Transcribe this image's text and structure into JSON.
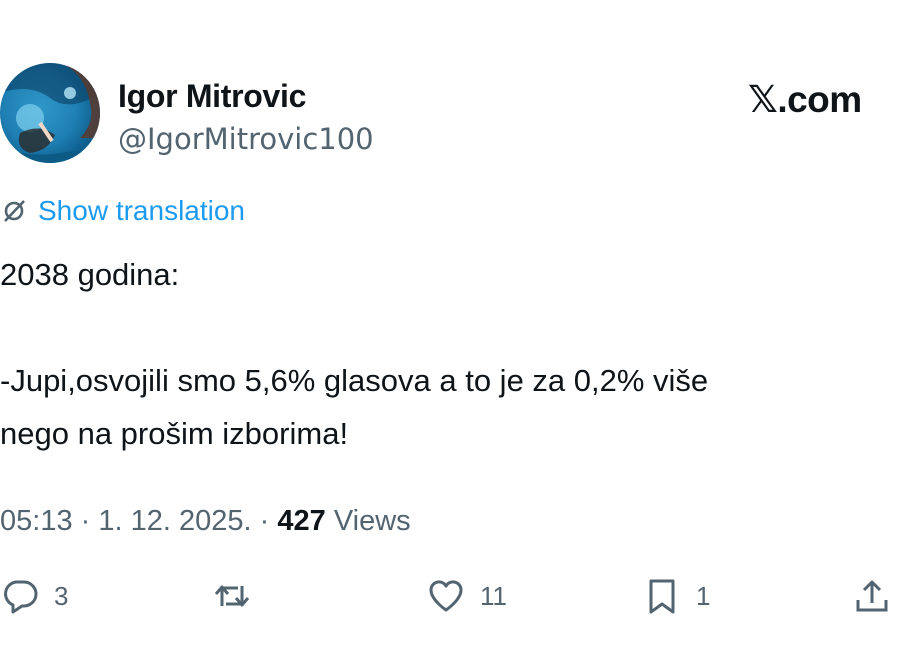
{
  "author": {
    "name": "Igor Mitrovic",
    "handle": "@IgorMitrovic100"
  },
  "brand": {
    "symbol": "𝕏",
    "text": ".com"
  },
  "translation_label": "Show translation",
  "tweet": {
    "lines": [
      "2038 godina:",
      "",
      "-Jupi,osvojili smo 5,6% glasova a to je za 0,2% više",
      "nego na prošim izborima!"
    ]
  },
  "meta": {
    "time": "05:13",
    "date": "1. 12. 2025.",
    "views_count": "427",
    "views_label": "Views",
    "separator": "·"
  },
  "actions": {
    "replies": "3",
    "reposts": "",
    "likes": "11",
    "bookmarks": "1"
  },
  "colors": {
    "text": "#0f1419",
    "secondary": "#536471",
    "link": "#1d9bf0"
  }
}
